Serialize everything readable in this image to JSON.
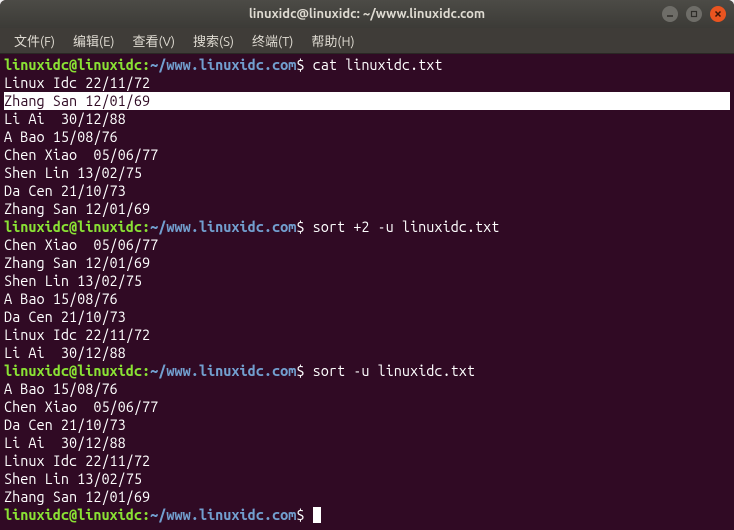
{
  "window": {
    "title": "linuxidc@linuxidc: ~/www.linuxidc.com"
  },
  "menu": {
    "file": "文件(F)",
    "edit": "编辑(E)",
    "view": "查看(V)",
    "search": "搜索(S)",
    "terminal": "终端(T)",
    "help": "帮助(H)"
  },
  "prompt": {
    "user": "linuxidc@linuxidc",
    "colon": ":",
    "path": "~/www.linuxidc.com",
    "dollar": "$"
  },
  "commands": {
    "cmd1": "cat linuxidc.txt",
    "cmd2": "sort +2 -u linuxidc.txt",
    "cmd3": "sort -u linuxidc.txt"
  },
  "output": {
    "block1": [
      "Linux Idc 22/11/72",
      "Zhang San 12/01/69",
      "Li Ai  30/12/88",
      "A Bao 15/08/76",
      "Chen Xiao  05/06/77",
      "Shen Lin 13/02/75",
      "Da Cen 21/10/73",
      "Zhang San 12/01/69"
    ],
    "block2": [
      "Chen Xiao  05/06/77",
      "Zhang San 12/01/69",
      "Shen Lin 13/02/75",
      "A Bao 15/08/76",
      "Da Cen 21/10/73",
      "Linux Idc 22/11/72",
      "Li Ai  30/12/88"
    ],
    "block3": [
      "A Bao 15/08/76",
      "Chen Xiao  05/06/77",
      "Da Cen 21/10/73",
      "Li Ai  30/12/88",
      "Linux Idc 22/11/72",
      "Shen Lin 13/02/75",
      "Zhang San 12/01/69"
    ]
  }
}
